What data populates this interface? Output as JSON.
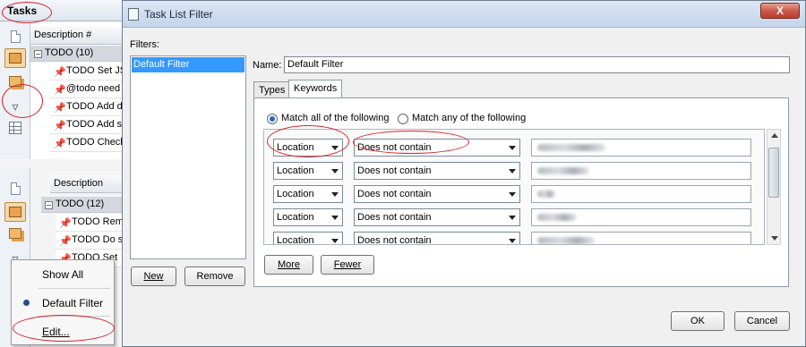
{
  "tasks_panel": {
    "title": "Tasks",
    "column_header": "Description",
    "column_header_short": "Description #",
    "groups": [
      {
        "label": "TODO (10)",
        "rows": [
          "TODO Set JS/",
          "@todo need v",
          "TODO Add do",
          "TODO Add sor",
          "TODO Check v"
        ]
      },
      {
        "label": "TODO (12)",
        "rows": [
          "TODO Rem",
          "TODO Do s",
          "TODO Set"
        ]
      }
    ]
  },
  "filter_menu": {
    "items": [
      "Show All",
      "Default Filter",
      "Edit..."
    ],
    "selected": "Default Filter"
  },
  "dialog": {
    "title": "Task List Filter",
    "close_label": "X",
    "filters_label": "Filters:",
    "filters": [
      "Default Filter"
    ],
    "name_label": "Name:",
    "name_value": "Default Filter",
    "new_button": "New",
    "remove_button": "Remove",
    "tabs": [
      "Types",
      "Keywords"
    ],
    "active_tab": "Keywords",
    "match_all_label": "Match all of the following",
    "match_any_label": "Match any of the following",
    "match_mode": "all",
    "rules": [
      {
        "field": "Location",
        "condition": "Does not contain"
      },
      {
        "field": "Location",
        "condition": "Does not contain"
      },
      {
        "field": "Location",
        "condition": "Does not contain"
      },
      {
        "field": "Location",
        "condition": "Does not contain"
      },
      {
        "field": "Location",
        "condition": "Does not contain"
      }
    ],
    "more_button": "More",
    "fewer_button": "Fewer",
    "ok_button": "OK",
    "cancel_button": "Cancel"
  },
  "colors": {
    "annotation": "#d8232a",
    "selection": "#3399ff",
    "close_button": "#c75545"
  }
}
